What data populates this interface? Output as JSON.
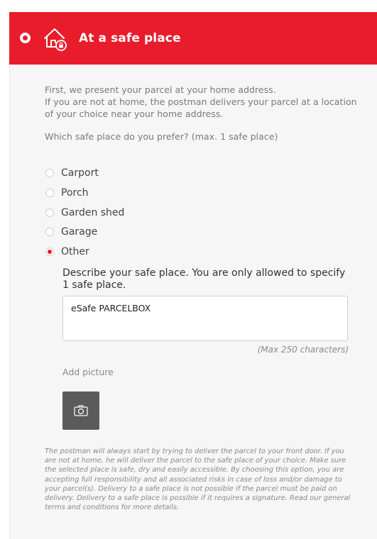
{
  "header": {
    "title": "At a safe place",
    "icon": "house-lock-icon",
    "accent": "#e91c2c"
  },
  "intro": "First, we present your parcel at your home address.\nIf you are not at home, the postman delivers your parcel at a location of your choice near your home address.",
  "question": "Which safe place do you prefer? (max. 1 safe place)",
  "options": [
    {
      "label": "Carport",
      "checked": false
    },
    {
      "label": "Porch",
      "checked": false
    },
    {
      "label": "Garden shed",
      "checked": false
    },
    {
      "label": "Garage",
      "checked": false
    },
    {
      "label": "Other",
      "checked": true
    }
  ],
  "other": {
    "describe": "Describe your safe place. You are only allowed to specify 1 safe place.",
    "value": "eSafe PARCELBOX",
    "max_chars": "(Max 250 characters)"
  },
  "picture": {
    "label": "Add picture",
    "icon": "camera-icon"
  },
  "disclaimer": "The postman will always start by trying to deliver the parcel to your front door. If you are not at home, he will deliver the parcel to the safe place of your choice. Make sure the selected place is safe, dry and easily accessible. By choosing this option, you are accepting full responsibility and all associated risks in case of loss and/or damage to your parcel(s). Delivery to a safe place is not possible if the parcel must be paid on delivery. Delivery to a safe place is possible if it requires a signature. Read our general terms and conditions for more details."
}
